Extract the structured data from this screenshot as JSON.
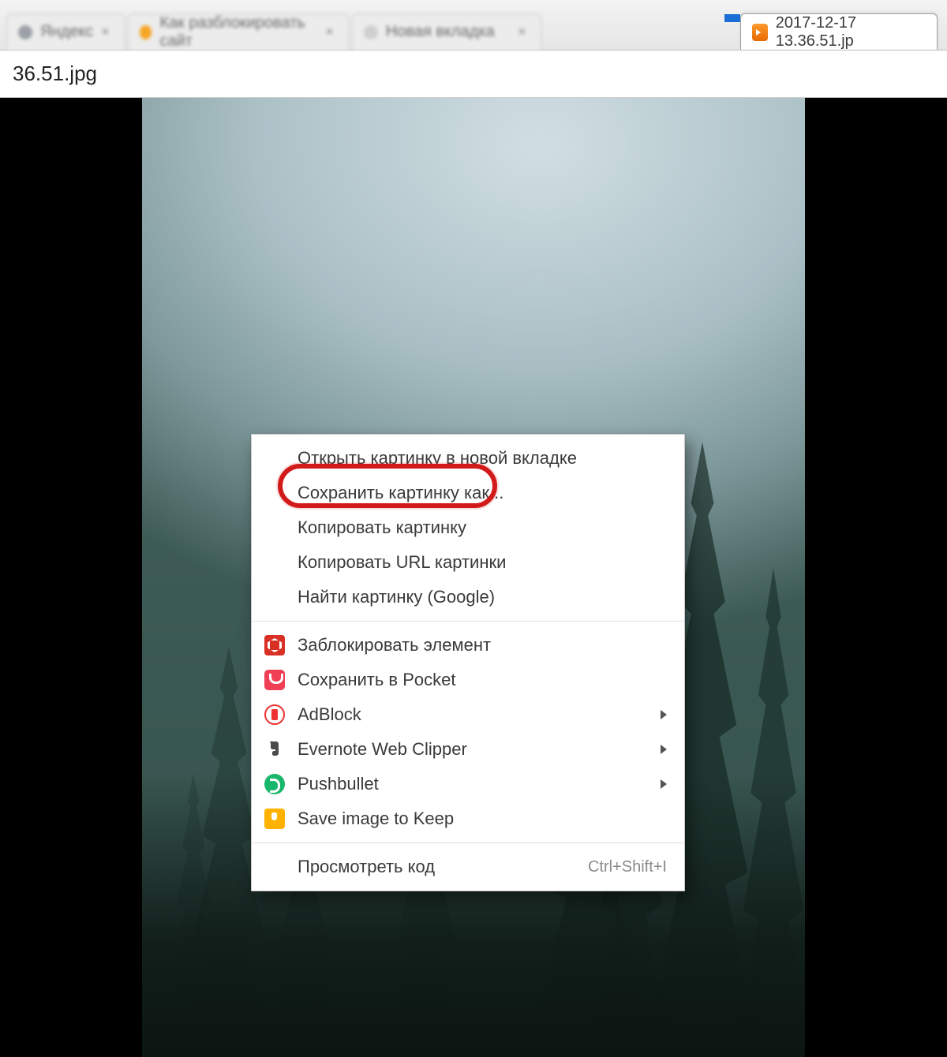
{
  "tabs": {
    "inactive1_label": "Яндекс",
    "inactive2_label": "Как разблокировать сайт",
    "inactive3_label": "Новая вкладка",
    "active_label": "2017-12-17 13.36.51.jp"
  },
  "addressbar": {
    "text": "36.51.jpg"
  },
  "context_menu": {
    "open_in_new_tab": "Открыть картинку в новой вкладке",
    "save_as": "Сохранить картинку как...",
    "copy_image": "Копировать картинку",
    "copy_image_url": "Копировать URL картинки",
    "search_image": "Найти картинку (Google)",
    "block_element": "Заблокировать элемент",
    "save_pocket": "Сохранить в Pocket",
    "adblock": "AdBlock",
    "evernote": "Evernote Web Clipper",
    "pushbullet": "Pushbullet",
    "save_keep": "Save image to Keep",
    "inspect": "Просмотреть код",
    "inspect_shortcut": "Ctrl+Shift+I"
  }
}
